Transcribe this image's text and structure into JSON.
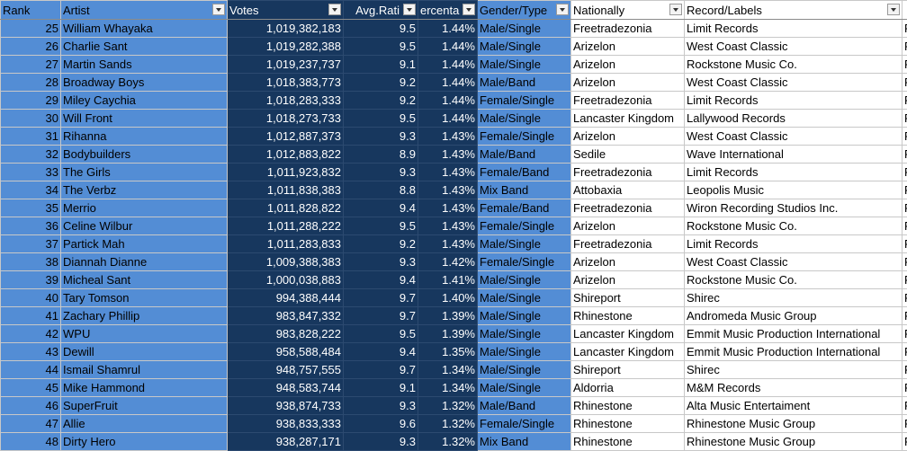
{
  "headers": {
    "rank": "Rank",
    "artist": "Artist",
    "votes": "Votes",
    "avg": "Avg.Rati",
    "pct": "ercenta",
    "gender": "Gender/Type",
    "nat": "Nationally",
    "rec": "Record/Labels",
    "extra": ""
  },
  "rows": [
    {
      "rank": "25",
      "artist": "William Whayaka",
      "votes": "1,019,382,183",
      "avg": "9.5",
      "pct": "1.44%",
      "gender": "Male/Single",
      "nat": "Freetradezonia",
      "rec": "Limit Records",
      "extra": "F"
    },
    {
      "rank": "26",
      "artist": "Charlie Sant",
      "votes": "1,019,282,388",
      "avg": "9.5",
      "pct": "1.44%",
      "gender": "Male/Single",
      "nat": "Arizelon",
      "rec": "West Coast Classic",
      "extra": "F"
    },
    {
      "rank": "27",
      "artist": "Martin Sands",
      "votes": "1,019,237,737",
      "avg": "9.1",
      "pct": "1.44%",
      "gender": "Male/Single",
      "nat": "Arizelon",
      "rec": "Rockstone Music Co.",
      "extra": "F"
    },
    {
      "rank": "28",
      "artist": "Broadway Boys",
      "votes": "1,018,383,773",
      "avg": "9.2",
      "pct": "1.44%",
      "gender": "Male/Band",
      "nat": "Arizelon",
      "rec": "West Coast Classic",
      "extra": "F"
    },
    {
      "rank": "29",
      "artist": "Miley Caychia",
      "votes": "1,018,283,333",
      "avg": "9.2",
      "pct": "1.44%",
      "gender": "Female/Single",
      "nat": "Freetradezonia",
      "rec": "Limit Records",
      "extra": "F"
    },
    {
      "rank": "30",
      "artist": "Will Front",
      "votes": "1,018,273,733",
      "avg": "9.5",
      "pct": "1.44%",
      "gender": "Male/Single",
      "nat": "Lancaster Kingdom",
      "rec": "Lallywood Records",
      "extra": "F"
    },
    {
      "rank": "31",
      "artist": "Rihanna",
      "votes": "1,012,887,373",
      "avg": "9.3",
      "pct": "1.43%",
      "gender": "Female/Single",
      "nat": "Arizelon",
      "rec": "West Coast Classic",
      "extra": "F"
    },
    {
      "rank": "32",
      "artist": "Bodybuilders",
      "votes": "1,012,883,822",
      "avg": "8.9",
      "pct": "1.43%",
      "gender": "Male/Band",
      "nat": "Sedile",
      "rec": "Wave International",
      "extra": "F"
    },
    {
      "rank": "33",
      "artist": "The Girls",
      "votes": "1,011,923,832",
      "avg": "9.3",
      "pct": "1.43%",
      "gender": "Female/Band",
      "nat": "Freetradezonia",
      "rec": "Limit Records",
      "extra": "F"
    },
    {
      "rank": "34",
      "artist": "The Verbz",
      "votes": "1,011,838,383",
      "avg": "8.8",
      "pct": "1.43%",
      "gender": "Mix Band",
      "nat": "Attobaxia",
      "rec": "Leopolis Music",
      "extra": "F"
    },
    {
      "rank": "35",
      "artist": "Merrio",
      "votes": "1,011,828,822",
      "avg": "9.4",
      "pct": "1.43%",
      "gender": "Female/Band",
      "nat": "Freetradezonia",
      "rec": "Wiron Recording Studios Inc.",
      "extra": "F"
    },
    {
      "rank": "36",
      "artist": "Celine Wilbur",
      "votes": "1,011,288,222",
      "avg": "9.5",
      "pct": "1.43%",
      "gender": "Female/Single",
      "nat": "Arizelon",
      "rec": "Rockstone Music Co.",
      "extra": "F"
    },
    {
      "rank": "37",
      "artist": "Partick Mah",
      "votes": "1,011,283,833",
      "avg": "9.2",
      "pct": "1.43%",
      "gender": "Male/Single",
      "nat": "Freetradezonia",
      "rec": "Limit Records",
      "extra": "F"
    },
    {
      "rank": "38",
      "artist": "Diannah Dianne",
      "votes": "1,009,388,383",
      "avg": "9.3",
      "pct": "1.42%",
      "gender": "Female/Single",
      "nat": "Arizelon",
      "rec": "West Coast Classic",
      "extra": "F"
    },
    {
      "rank": "39",
      "artist": "Micheal Sant",
      "votes": "1,000,038,883",
      "avg": "9.4",
      "pct": "1.41%",
      "gender": "Male/Single",
      "nat": "Arizelon",
      "rec": "Rockstone Music Co.",
      "extra": "F"
    },
    {
      "rank": "40",
      "artist": "Tary Tomson",
      "votes": "994,388,444",
      "avg": "9.7",
      "pct": "1.40%",
      "gender": "Male/Single",
      "nat": "Shireport",
      "rec": "Shirec",
      "extra": "F"
    },
    {
      "rank": "41",
      "artist": "Zachary Phillip",
      "votes": "983,847,332",
      "avg": "9.7",
      "pct": "1.39%",
      "gender": "Male/Single",
      "nat": "Rhinestone",
      "rec": "Andromeda Music Group",
      "extra": "F"
    },
    {
      "rank": "42",
      "artist": "WPU",
      "votes": "983,828,222",
      "avg": "9.5",
      "pct": "1.39%",
      "gender": "Male/Single",
      "nat": "Lancaster Kingdom",
      "rec": "Emmit Music Production International",
      "extra": "F"
    },
    {
      "rank": "43",
      "artist": "Dewill",
      "votes": "958,588,484",
      "avg": "9.4",
      "pct": "1.35%",
      "gender": "Male/Single",
      "nat": "Lancaster Kingdom",
      "rec": "Emmit Music Production International",
      "extra": "F"
    },
    {
      "rank": "44",
      "artist": "Ismail Shamrul",
      "votes": "948,757,555",
      "avg": "9.7",
      "pct": "1.34%",
      "gender": "Male/Single",
      "nat": "Shireport",
      "rec": "Shirec",
      "extra": "F"
    },
    {
      "rank": "45",
      "artist": "Mike Hammond",
      "votes": "948,583,744",
      "avg": "9.1",
      "pct": "1.34%",
      "gender": "Male/Single",
      "nat": "Aldorria",
      "rec": "M&M Records",
      "extra": "F"
    },
    {
      "rank": "46",
      "artist": "SuperFruit",
      "votes": "938,874,733",
      "avg": "9.3",
      "pct": "1.32%",
      "gender": "Male/Band",
      "nat": "Rhinestone",
      "rec": "Alta Music Entertaiment",
      "extra": "F"
    },
    {
      "rank": "47",
      "artist": "Allie",
      "votes": "938,833,333",
      "avg": "9.6",
      "pct": "1.32%",
      "gender": "Female/Single",
      "nat": "Rhinestone",
      "rec": "Rhinestone Music Group",
      "extra": "F"
    },
    {
      "rank": "48",
      "artist": "Dirty Hero",
      "votes": "938,287,171",
      "avg": "9.3",
      "pct": "1.32%",
      "gender": "Mix Band",
      "nat": "Rhinestone",
      "rec": "Rhinestone Music Group",
      "extra": "F"
    }
  ]
}
